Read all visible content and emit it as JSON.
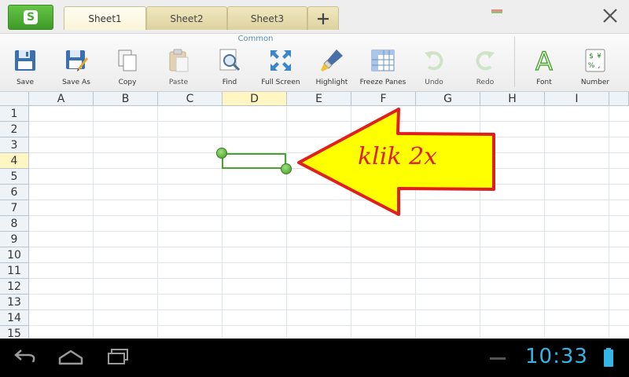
{
  "app": {
    "button_letter": "S"
  },
  "tabs": [
    {
      "label": "Sheet1",
      "active": true
    },
    {
      "label": "Sheet2",
      "active": false
    },
    {
      "label": "Sheet3",
      "active": false
    }
  ],
  "ribbon": {
    "group_label": "Common",
    "tools": [
      {
        "label": "Save",
        "icon": "floppy-disk-icon",
        "enabled": true
      },
      {
        "label": "Save As",
        "icon": "save-as-icon",
        "enabled": true
      },
      {
        "label": "Copy",
        "icon": "copy-icon",
        "enabled": true
      },
      {
        "label": "Paste",
        "icon": "paste-icon",
        "enabled": false
      },
      {
        "label": "Find",
        "icon": "magnifier-icon",
        "enabled": true
      },
      {
        "label": "Full Screen",
        "icon": "fullscreen-icon",
        "enabled": true
      },
      {
        "label": "Highlight",
        "icon": "highlighter-icon",
        "enabled": true
      },
      {
        "label": "Freeze Panes",
        "icon": "freeze-panes-icon",
        "enabled": true
      },
      {
        "label": "Undo",
        "icon": "undo-icon",
        "enabled": false
      },
      {
        "label": "Redo",
        "icon": "redo-icon",
        "enabled": false
      },
      {
        "label": "Font",
        "icon": "font-icon",
        "enabled": true
      },
      {
        "label": "Number",
        "icon": "number-format-icon",
        "enabled": true
      }
    ]
  },
  "grid": {
    "columns": [
      "A",
      "B",
      "C",
      "D",
      "E",
      "F",
      "G",
      "H",
      "I"
    ],
    "rows": [
      "1",
      "2",
      "3",
      "4",
      "5",
      "6",
      "7",
      "8",
      "9",
      "10",
      "11",
      "12",
      "13",
      "14",
      "15"
    ],
    "selected_column": "D",
    "selected_row": "4"
  },
  "annotation": {
    "text": "klik 2x",
    "color": "#e0201c",
    "fill": "#ffff00"
  },
  "statusbar": {
    "time": "10:33"
  },
  "colors": {
    "accent_green": "#4aa22e",
    "clock_blue": "#33b5e5",
    "tab_yellow": "#f0e8bf"
  }
}
